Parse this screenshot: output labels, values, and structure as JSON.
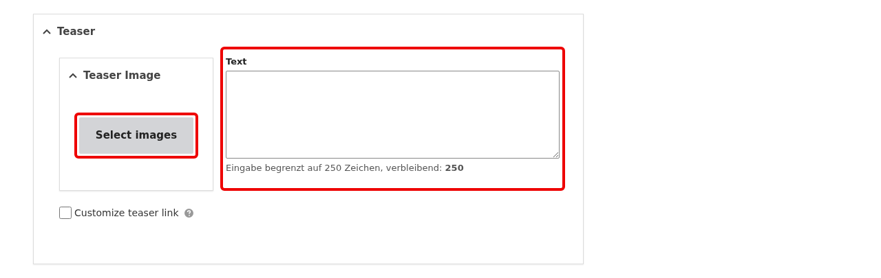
{
  "section": {
    "title": "Teaser",
    "expanded": true
  },
  "image_panel": {
    "title": "Teaser Image",
    "expanded": true,
    "button": {
      "label": "Select images",
      "highlighted": true
    }
  },
  "text_field": {
    "label": "Text",
    "hint": "Eingabe begrenzt auf 250 Zeichen, verbleibend: **250**",
    "highlighted": true
  },
  "checkbox": {
    "label": "Customize teaser link",
    "checked": false
  }
}
